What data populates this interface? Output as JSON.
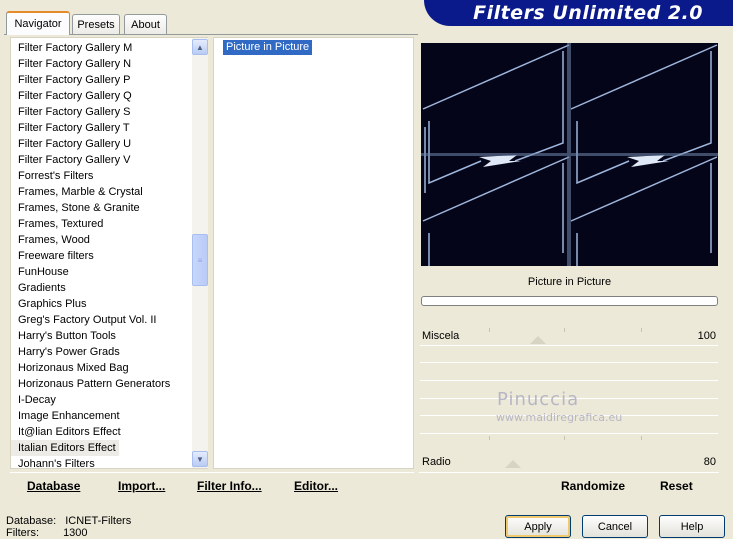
{
  "tabs": [
    {
      "label": "Navigator",
      "active": true
    },
    {
      "label": "Presets",
      "active": false
    },
    {
      "label": "About",
      "active": false
    }
  ],
  "app_title": "Filters Unlimited 2.0",
  "categories": [
    "Filter Factory Gallery M",
    "Filter Factory Gallery N",
    "Filter Factory Gallery P",
    "Filter Factory Gallery Q",
    "Filter Factory Gallery S",
    "Filter Factory Gallery T",
    "Filter Factory Gallery U",
    "Filter Factory Gallery V",
    "Forrest's Filters",
    "Frames, Marble & Crystal",
    "Frames, Stone & Granite",
    "Frames, Textured",
    "Frames, Wood",
    "Freeware filters",
    "FunHouse",
    "Gradients",
    "Graphics Plus",
    "Greg's Factory Output Vol. II",
    "Harry's Button Tools",
    "Harry's Power Grads",
    "Horizonaus Mixed Bag",
    "Horizonaus Pattern Generators",
    "I-Decay",
    "Image Enhancement",
    "It@lian Editors Effect",
    "Italian Editors Effect",
    "Johann's Filters"
  ],
  "selected_category": "Italian Editors Effect",
  "filters": [
    "Picture in Picture"
  ],
  "selected_filter": "Picture in Picture",
  "preview_filter_name": "Picture in Picture",
  "sliders": [
    {
      "label": "Miscela",
      "value": "100"
    },
    {
      "label": "Radio",
      "value": "80"
    }
  ],
  "watermark": {
    "title": "Pinuccia",
    "subtitle": "www.maidiregrafica.eu"
  },
  "toolbar": {
    "database": "Database",
    "import": "Import...",
    "filter_info": "Filter Info...",
    "editor": "Editor...",
    "randomize": "Randomize",
    "reset": "Reset"
  },
  "status": {
    "database_label": "Database:",
    "database_value": "ICNET-Filters",
    "filters_label": "Filters:",
    "filters_value": "1300"
  },
  "dialog": {
    "apply": "Apply",
    "cancel": "Cancel",
    "help": "Help"
  },
  "colors": {
    "banner": "#0a1a8a",
    "selection": "#316ac5",
    "preview_bg": "#05051a",
    "frame_line": "#9fb7dc"
  }
}
